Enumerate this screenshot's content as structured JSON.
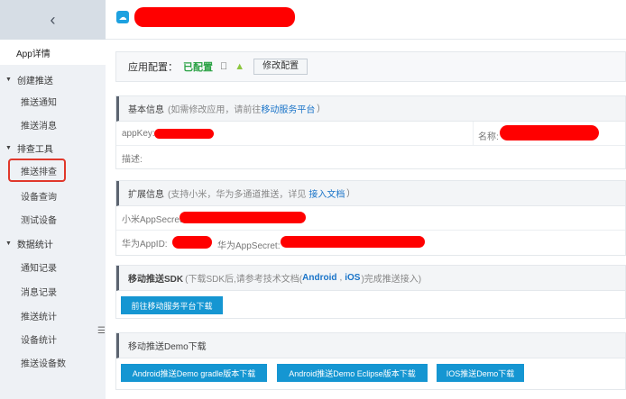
{
  "sidebar": {
    "back_icon": "chevron-left-icon",
    "active_item": "App详情",
    "groups": [
      {
        "label": "创建推送",
        "items": [
          "推送通知",
          "推送消息"
        ]
      },
      {
        "label": "排查工具",
        "items": [
          "推送排查",
          "设备查询",
          "测试设备"
        ]
      },
      {
        "label": "数据统计",
        "items": [
          "通知记录",
          "消息记录",
          "推送统计",
          "设备统计",
          "推送设备数"
        ]
      }
    ]
  },
  "config": {
    "label": "应用配置：",
    "status": "已配置",
    "edit_button": "修改配置"
  },
  "basic_info": {
    "title": "基本信息",
    "subtitle_prefix": "(如需修改应用，请前往",
    "subtitle_link": "移动服务平台",
    "subtitle_suffix": ")",
    "appkey_label": "appKey:",
    "name_label": "名称:",
    "desc_label": "描述:"
  },
  "ext_info": {
    "title": "扩展信息",
    "subtitle_prefix": "(支持小米，华为多通道推送，详见",
    "subtitle_link": "接入文档",
    "subtitle_suffix": ")",
    "xiaomi_label": "小米AppSecret:",
    "huawei_appid_label": "华为AppID:",
    "huawei_secret_label": "华为AppSecret:"
  },
  "sdk": {
    "title": "移动推送SDK",
    "subtitle_prefix": "(下载SDK后,请参考技术文档(",
    "link_android": "Android",
    "comma": ",",
    "link_ios": "iOS",
    "subtitle_suffix": ")完成推送接入)",
    "download_button": "前往移动服务平台下载"
  },
  "demo": {
    "title": "移动推送Demo下载",
    "btn_gradle": "Android推送Demo gradle版本下载",
    "btn_eclipse": "Android推送Demo Eclipse版本下载",
    "btn_ios": "IOS推送Demo下载"
  },
  "colors": {
    "accent": "#1596d2",
    "link": "#1a74c8",
    "status_green": "#2ba245",
    "redaction": "#ff0000",
    "highlight_border": "#e0382b"
  }
}
